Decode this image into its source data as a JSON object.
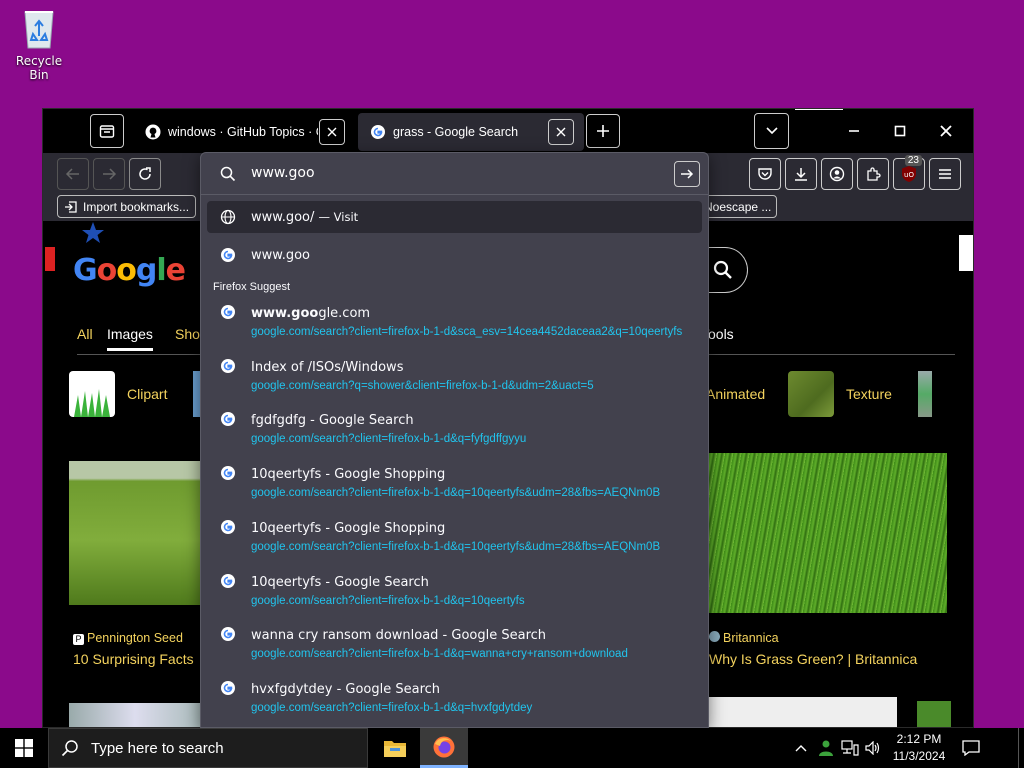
{
  "desktop": {
    "recycle_bin_label": "Recycle Bin"
  },
  "tabs": [
    {
      "title": "windows · GitHub Topics · GitHub",
      "icon": "github-icon"
    },
    {
      "title": "grass - Google Search",
      "icon": "google-icon"
    }
  ],
  "bookmarks": {
    "import_label": "Import bookmarks...",
    "noscape_label": "Noescape ..."
  },
  "toolbar": {
    "extensions_badge": "23"
  },
  "urlbar": {
    "value": "www.goo",
    "visit_row": {
      "title": "www.goo/",
      "action": "— Visit"
    },
    "search_row": {
      "title": "www.goo"
    },
    "section_label": "Firefox Suggest",
    "suggestions": [
      {
        "title_bold": "www.goo",
        "title_rest": "gle.com",
        "url": "google.com/search?client=firefox-b-1-d&sca_esv=14cea4452daceaa2&q=10qeertyfs"
      },
      {
        "title_bold": "",
        "title_rest": "Index of /ISOs/Windows",
        "url": "google.com/search?q=shower&client=firefox-b-1-d&udm=2&uact=5"
      },
      {
        "title_bold": "",
        "title_rest": "fgdfgdfg - Google Search",
        "url": "google.com/search?client=firefox-b-1-d&q=fyfgdffgyyu"
      },
      {
        "title_bold": "",
        "title_rest": "10qeertyfs - Google Shopping",
        "url": "google.com/search?client=firefox-b-1-d&q=10qeertyfs&udm=28&fbs=AEQNm0B"
      },
      {
        "title_bold": "",
        "title_rest": "10qeertyfs - Google Shopping",
        "url": "google.com/search?client=firefox-b-1-d&q=10qeertyfs&udm=28&fbs=AEQNm0B"
      },
      {
        "title_bold": "",
        "title_rest": "10qeertyfs - Google Search",
        "url": "google.com/search?client=firefox-b-1-d&q=10qeertyfs"
      },
      {
        "title_bold": "",
        "title_rest": "wanna cry ransom download - Google Search",
        "url": "google.com/search?client=firefox-b-1-d&q=wanna+cry+ransom+download"
      },
      {
        "title_bold": "",
        "title_rest": "hvxfgdytdey - Google Search",
        "url": "google.com/search?client=firefox-b-1-d&q=hvxfgdytdey"
      }
    ]
  },
  "page": {
    "logo": "Google",
    "tabs": {
      "all": "All",
      "images": "Images",
      "shopping": "Sho",
      "tools": "Tools"
    },
    "chips": {
      "clipart": "Clipart",
      "animated": "Animated",
      "texture": "Texture"
    },
    "results": [
      {
        "source": "Pennington Seed",
        "title": "10 Surprising Facts"
      },
      {
        "source": "Britannica",
        "title": "Why Is Grass Green? | Britannica"
      }
    ]
  },
  "taskbar": {
    "search_placeholder": "Type here to search",
    "time": "2:12 PM",
    "date": "11/3/2024"
  }
}
